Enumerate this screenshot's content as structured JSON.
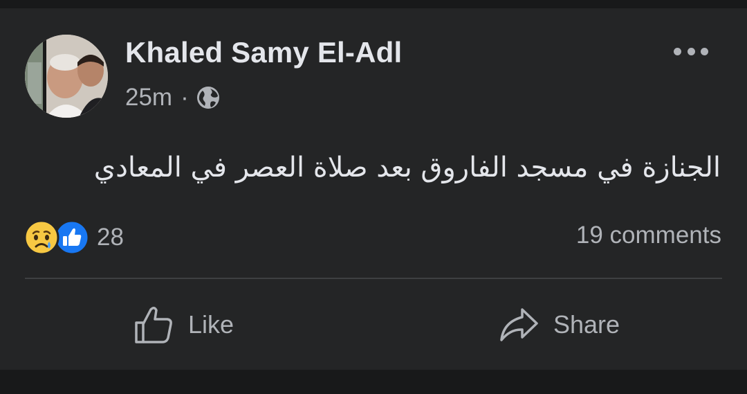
{
  "post": {
    "author_name": "Khaled Samy El-Adl",
    "time": "25m",
    "separator": "·",
    "privacy_icon": "globe-icon",
    "text": "الجنازة في مسجد الفاروق بعد صلاة العصر في المعادي",
    "reaction_icons": [
      "sad-icon",
      "like-icon"
    ],
    "reaction_count": "28",
    "comments_label": "19 comments"
  },
  "actions": {
    "like_label": "Like",
    "share_label": "Share"
  },
  "colors": {
    "background": "#18191a",
    "card": "#242526",
    "primary_text": "#e4e6eb",
    "secondary_text": "#b0b3b8",
    "like_blue": "#1877f2",
    "divider": "#3e4042"
  }
}
